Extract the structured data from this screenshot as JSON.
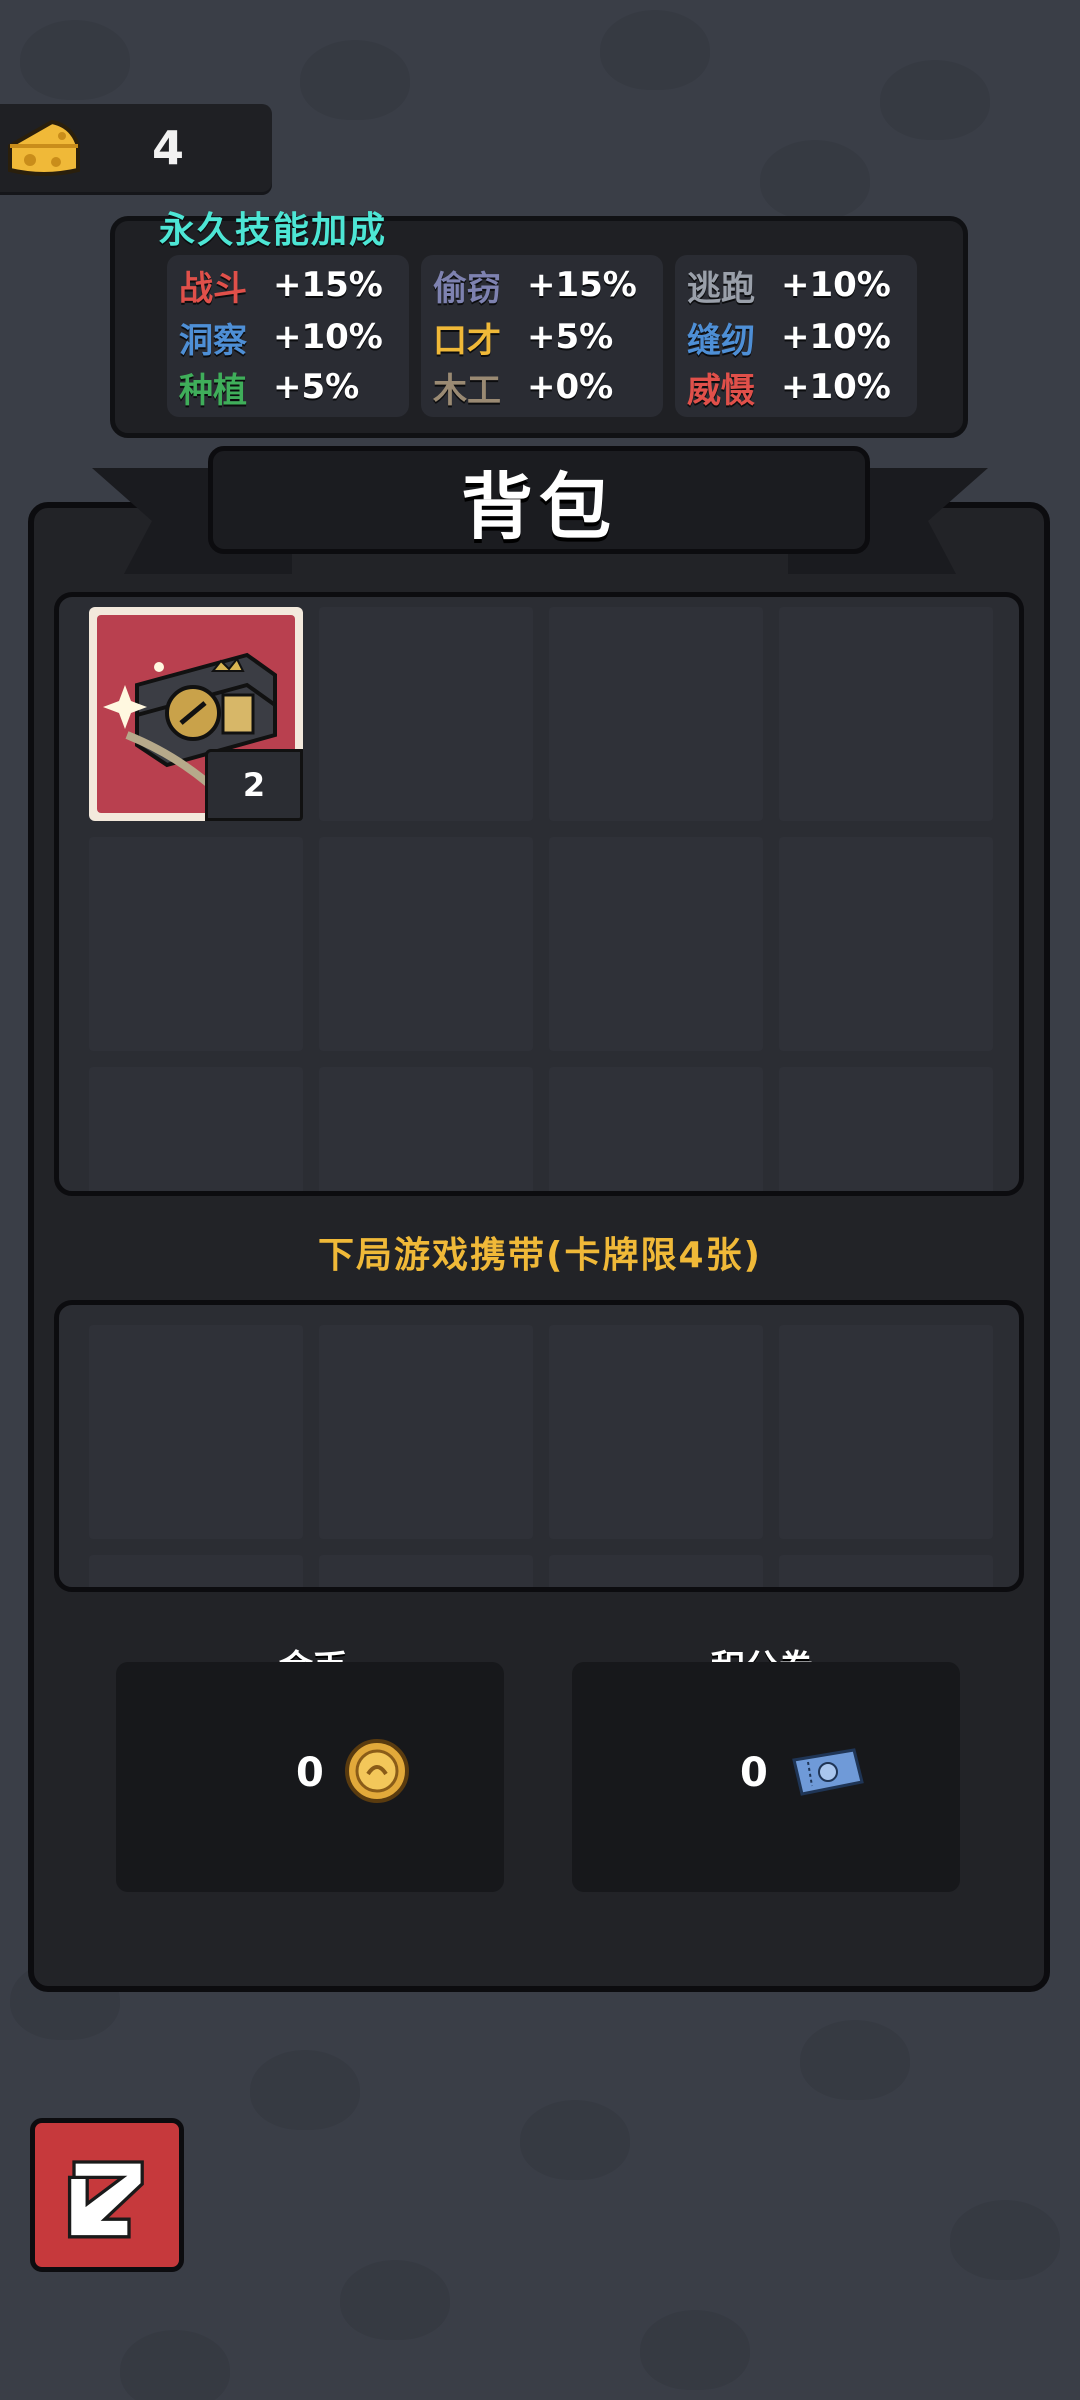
{
  "cheese": {
    "count": "4",
    "icon": "cheese-icon"
  },
  "skills": {
    "title": "永久技能加成",
    "columns": [
      [
        {
          "name": "战斗",
          "value": "+15%",
          "color": "#e0504a"
        },
        {
          "name": "洞察",
          "value": "+10%",
          "color": "#4e8fd6"
        },
        {
          "name": "种植",
          "value": "+5%",
          "color": "#3fae5a"
        }
      ],
      [
        {
          "name": "偷窃",
          "value": "+15%",
          "color": "#7e82b0"
        },
        {
          "name": "口才",
          "value": "+5%",
          "color": "#f0b938"
        },
        {
          "name": "木工",
          "value": "+0%",
          "color": "#9a8a73"
        }
      ],
      [
        {
          "name": "逃跑",
          "value": "+10%",
          "color": "#9aa0aa"
        },
        {
          "name": "缝纫",
          "value": "+10%",
          "color": "#4e8fd6"
        },
        {
          "name": "威慑",
          "value": "+10%",
          "color": "#e0504a"
        }
      ]
    ]
  },
  "backpack": {
    "title": "背包",
    "item": {
      "icon": "gift-box-icon",
      "quantity": "2"
    }
  },
  "carry": {
    "label": "下局游戏携带(卡牌限4张)"
  },
  "currency": {
    "gold_label": "金币",
    "gold_value": "0",
    "gold_icon": "gold-coin-icon",
    "voucher_label": "积分券",
    "voucher_value": "0",
    "voucher_icon": "voucher-ticket-icon"
  },
  "back_button": {
    "icon": "back-arrow-icon"
  }
}
